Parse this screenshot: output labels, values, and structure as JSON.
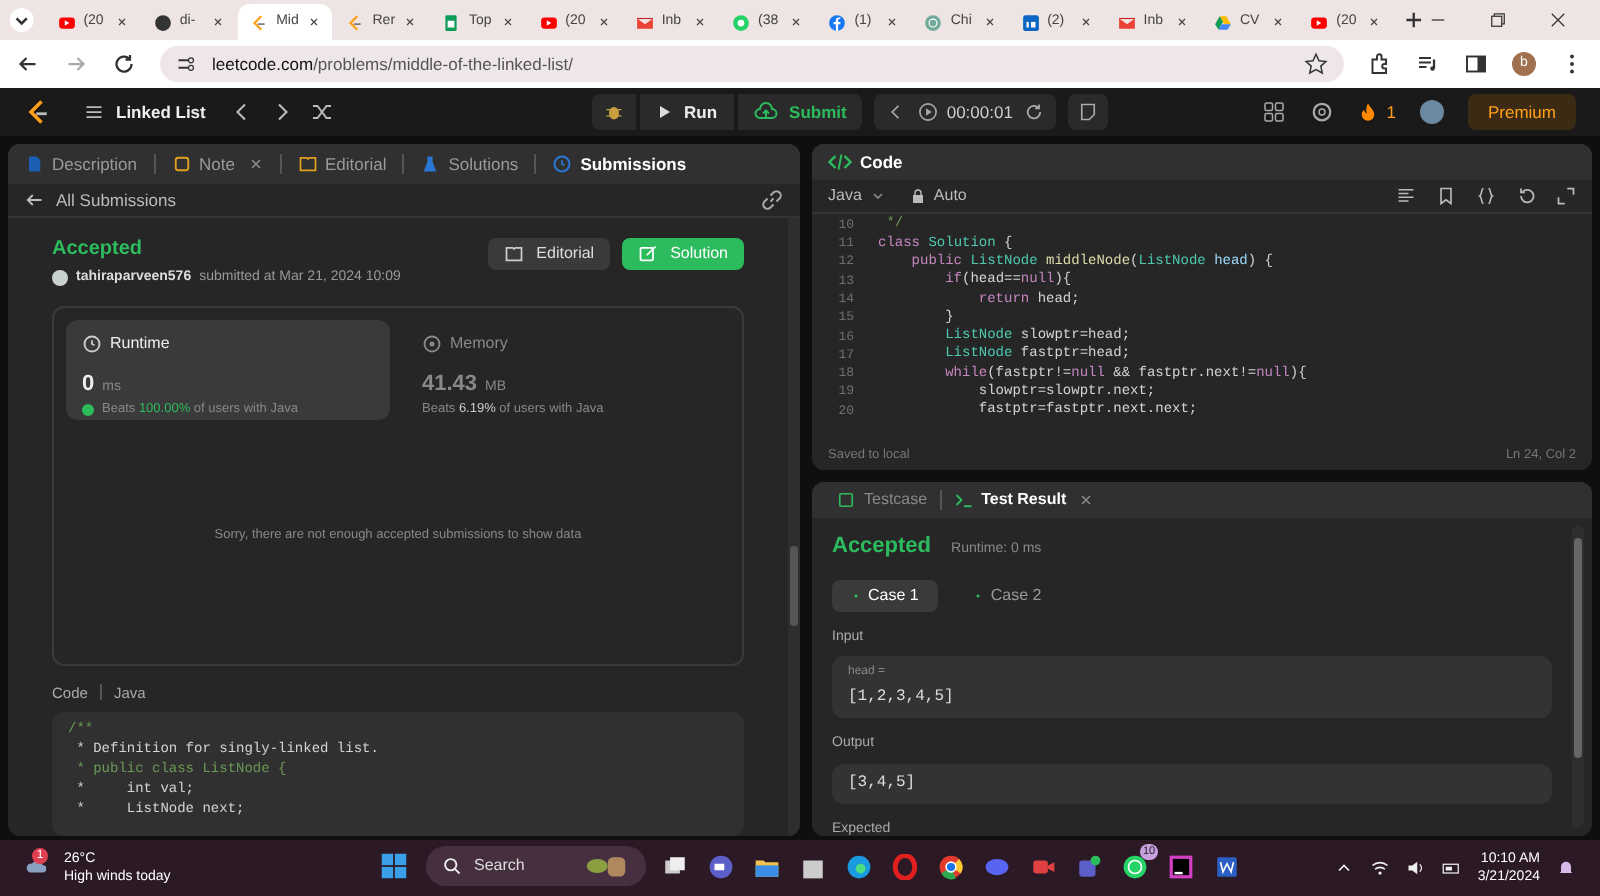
{
  "browser": {
    "tabs": [
      {
        "label": "(20",
        "kind": "youtube",
        "selected": false
      },
      {
        "label": "di-",
        "kind": "github",
        "selected": false
      },
      {
        "label": "Mid",
        "kind": "leetcode",
        "selected": true
      },
      {
        "label": "Rer",
        "kind": "leetcode",
        "selected": false
      },
      {
        "label": "Top",
        "kind": "sheets",
        "selected": false
      },
      {
        "label": "(20",
        "kind": "youtube",
        "selected": false
      },
      {
        "label": "Inb",
        "kind": "gmail",
        "selected": false
      },
      {
        "label": "(38",
        "kind": "chat",
        "selected": false
      },
      {
        "label": "(1)",
        "kind": "facebook",
        "selected": false
      },
      {
        "label": "Chi",
        "kind": "gpt",
        "selected": false
      },
      {
        "label": "(2)",
        "kind": "linkedin",
        "selected": false
      },
      {
        "label": "Inb",
        "kind": "gmail",
        "selected": false
      },
      {
        "label": "CV",
        "kind": "drive",
        "selected": false
      },
      {
        "label": "(20",
        "kind": "youtube",
        "selected": false
      }
    ],
    "url_host": "leetcode.com",
    "url_path": "/problems/middle-of-the-linked-list/",
    "profile": "b"
  },
  "navbar": {
    "problem_list": "Linked List",
    "run": "Run",
    "submit": "Submit",
    "timer": "00:00:01",
    "streak": "1",
    "premium": "Premium"
  },
  "left_panel": {
    "tabs": [
      {
        "label": "Description",
        "selected": false,
        "closable": false
      },
      {
        "label": "Note",
        "selected": false,
        "closable": true
      },
      {
        "label": "Editorial",
        "selected": false,
        "closable": false
      },
      {
        "label": "Solutions",
        "selected": false,
        "closable": false
      },
      {
        "label": "Submissions",
        "selected": true,
        "closable": false
      }
    ],
    "back": "All Submissions",
    "status": "Accepted",
    "user": "tahiraparveen576",
    "submitted": "submitted at Mar 21, 2024 10:09",
    "buttons": [
      {
        "label": "Editorial",
        "kind": "secondary"
      },
      {
        "label": "Solution",
        "kind": "primary"
      }
    ],
    "stats": [
      {
        "title": "Runtime",
        "value": "0",
        "unit": "ms",
        "beats": "Beats",
        "percent": "100.00%",
        "suffix": "of users with Java",
        "selected": true
      },
      {
        "title": "Memory",
        "value": "41.43",
        "unit": "MB",
        "beats": "Beats",
        "percent": "6.19%",
        "suffix": "of users with Java",
        "selected": false
      }
    ],
    "chart_message": "Sorry, there are not enough accepted submissions to show data",
    "code_label": "Code",
    "code_language": "Java",
    "code_lines": [
      [
        {
          "t": "/**",
          "kind": "comment"
        }
      ],
      [
        {
          "t": " * Definition for singly-linked list.",
          "kind": "plain"
        }
      ],
      [
        {
          "t": " * public class ListNode {",
          "kind": "comment"
        }
      ],
      [
        {
          "t": " *     int val;",
          "kind": "plain"
        }
      ],
      [
        {
          "t": " *     ListNode next;",
          "kind": "plain"
        }
      ]
    ]
  },
  "editor": {
    "title": "Code",
    "language": "Java",
    "mode": "Auto",
    "lines": [
      {
        "n": "10",
        "seg": [
          {
            "t": " */",
            "kind": "comment"
          }
        ]
      },
      {
        "n": "11",
        "seg": [
          {
            "t": "class ",
            "kind": "keyword"
          },
          {
            "t": "Solution",
            "kind": "type"
          },
          {
            "t": " {",
            "kind": "plain"
          }
        ]
      },
      {
        "n": "12",
        "seg": [
          {
            "t": "    public ",
            "kind": "keyword"
          },
          {
            "t": "ListNode ",
            "kind": "type"
          },
          {
            "t": "middleNode",
            "kind": "fn"
          },
          {
            "t": "(",
            "kind": "plain"
          },
          {
            "t": "ListNode ",
            "kind": "type"
          },
          {
            "t": "head",
            "kind": "var"
          },
          {
            "t": ") {",
            "kind": "plain"
          }
        ]
      },
      {
        "n": "13",
        "seg": [
          {
            "t": "        if",
            "kind": "keyword"
          },
          {
            "t": "(head==",
            "kind": "plain"
          },
          {
            "t": "null",
            "kind": "keyword"
          },
          {
            "t": "){",
            "kind": "plain"
          }
        ]
      },
      {
        "n": "14",
        "seg": [
          {
            "t": "            return",
            "kind": "keyword"
          },
          {
            "t": " head;",
            "kind": "plain"
          }
        ]
      },
      {
        "n": "15",
        "seg": [
          {
            "t": "        }",
            "kind": "plain"
          }
        ]
      },
      {
        "n": "16",
        "seg": [
          {
            "t": "        ListNode",
            "kind": "type"
          },
          {
            "t": " slowptr=head;",
            "kind": "plain"
          }
        ]
      },
      {
        "n": "17",
        "seg": [
          {
            "t": "        ListNode",
            "kind": "type"
          },
          {
            "t": " fastptr=head;",
            "kind": "plain"
          }
        ]
      },
      {
        "n": "18",
        "seg": [
          {
            "t": "        while",
            "kind": "keyword"
          },
          {
            "t": "(fastptr!=",
            "kind": "plain"
          },
          {
            "t": "null",
            "kind": "keyword"
          },
          {
            "t": " && fastptr.next!=",
            "kind": "plain"
          },
          {
            "t": "null",
            "kind": "keyword"
          },
          {
            "t": "){",
            "kind": "plain"
          }
        ]
      },
      {
        "n": "19",
        "seg": [
          {
            "t": "            slowptr=slowptr.next;",
            "kind": "plain"
          }
        ]
      },
      {
        "n": "20",
        "seg": [
          {
            "t": "            fastptr=fastptr.next.next;",
            "kind": "plain"
          }
        ]
      }
    ],
    "saved": "Saved to local",
    "cursor": "Ln 24, Col 2"
  },
  "results": {
    "tabs": [
      {
        "label": "Testcase",
        "selected": false,
        "closable": false
      },
      {
        "label": "Test Result",
        "selected": true,
        "closable": true
      }
    ],
    "verdict": "Accepted",
    "runtime": "Runtime: 0 ms",
    "cases": [
      {
        "label": "Case 1",
        "selected": true
      },
      {
        "label": "Case 2",
        "selected": false
      }
    ],
    "input_label": "Input",
    "param": "head =",
    "input": "[1,2,3,4,5]",
    "output_label": "Output",
    "output": "[3,4,5]",
    "expected_label": "Expected"
  },
  "taskbar": {
    "weather_badge": "1",
    "temperature": "26°C",
    "weather": "High winds today",
    "search": "Search",
    "apps": [
      {
        "kind": "widgets"
      },
      {
        "kind": "files"
      },
      {
        "kind": "folder"
      },
      {
        "kind": "store"
      },
      {
        "kind": "edge"
      },
      {
        "kind": "opera"
      },
      {
        "kind": "chrome"
      },
      {
        "kind": "discord"
      },
      {
        "kind": "recorder"
      },
      {
        "kind": "teams"
      },
      {
        "kind": "whatsapp",
        "badge": "10"
      },
      {
        "kind": "intellij"
      },
      {
        "kind": "word"
      }
    ],
    "time": "10:10 AM",
    "date": "3/21/2024"
  }
}
